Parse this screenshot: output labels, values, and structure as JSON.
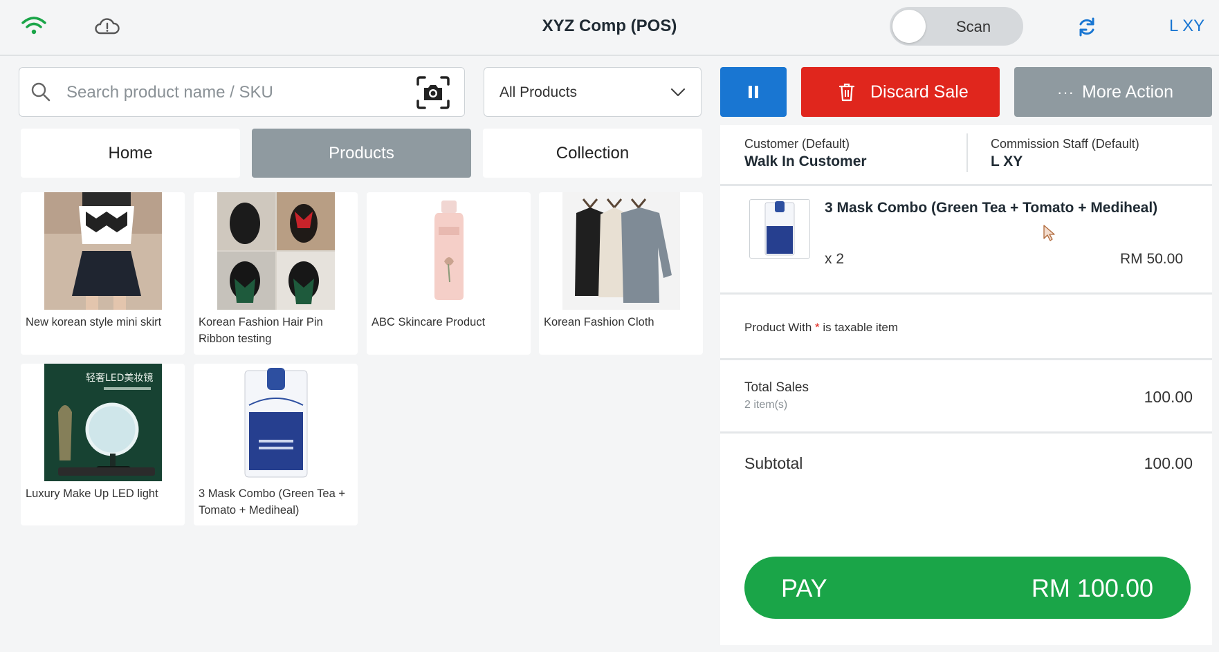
{
  "header": {
    "title": "XYZ Comp (POS)",
    "scan_label": "Scan",
    "user_name": "L XY",
    "icons": {
      "wifi": "wifi-icon",
      "cloud": "cloud-alert-icon",
      "sync": "sync-icon"
    },
    "colors": {
      "wifi": "#1aa548",
      "accent": "#1976d2"
    }
  },
  "search": {
    "placeholder": "Search product name / SKU",
    "value": ""
  },
  "filter": {
    "selected": "All Products"
  },
  "tabs": [
    {
      "label": "Home",
      "active": false
    },
    {
      "label": "Products",
      "active": true
    },
    {
      "label": "Collection",
      "active": false
    }
  ],
  "products": [
    {
      "name": "New korean style mini skirt"
    },
    {
      "name": "Korean Fashion Hair Pin Ribbon testing"
    },
    {
      "name": "ABC Skincare Product"
    },
    {
      "name": "Korean Fashion Cloth"
    },
    {
      "name": "Luxury Make Up LED light",
      "image_text": "轻奢LED美妆镜"
    },
    {
      "name": "3 Mask Combo (Green Tea + Tomato + Mediheal)"
    }
  ],
  "actions": {
    "discard_label": "Discard Sale",
    "more_label": "More Action",
    "colors": {
      "pause": "#1976d2",
      "discard": "#e0261d",
      "more": "#8f9aa0"
    }
  },
  "cart": {
    "customer_label": "Customer  (Default)",
    "customer_value": "Walk In Customer",
    "staff_label": "Commission Staff  (Default)",
    "staff_value": "L XY",
    "items": [
      {
        "name": "3 Mask Combo (Green Tea + Tomato + Mediheal)",
        "qty": "x 2",
        "price": "RM 50.00"
      }
    ],
    "tax_note_prefix": "Product With ",
    "tax_note_star": "*",
    "tax_note_suffix": " is taxable item",
    "total_sales_label": "Total Sales",
    "total_sales_items": "2 item(s)",
    "total_sales_value": "100.00",
    "subtotal_label": "Subtotal",
    "subtotal_value": "100.00",
    "pay_label": "PAY",
    "pay_amount": "RM 100.00",
    "pay_color": "#1aa548"
  }
}
